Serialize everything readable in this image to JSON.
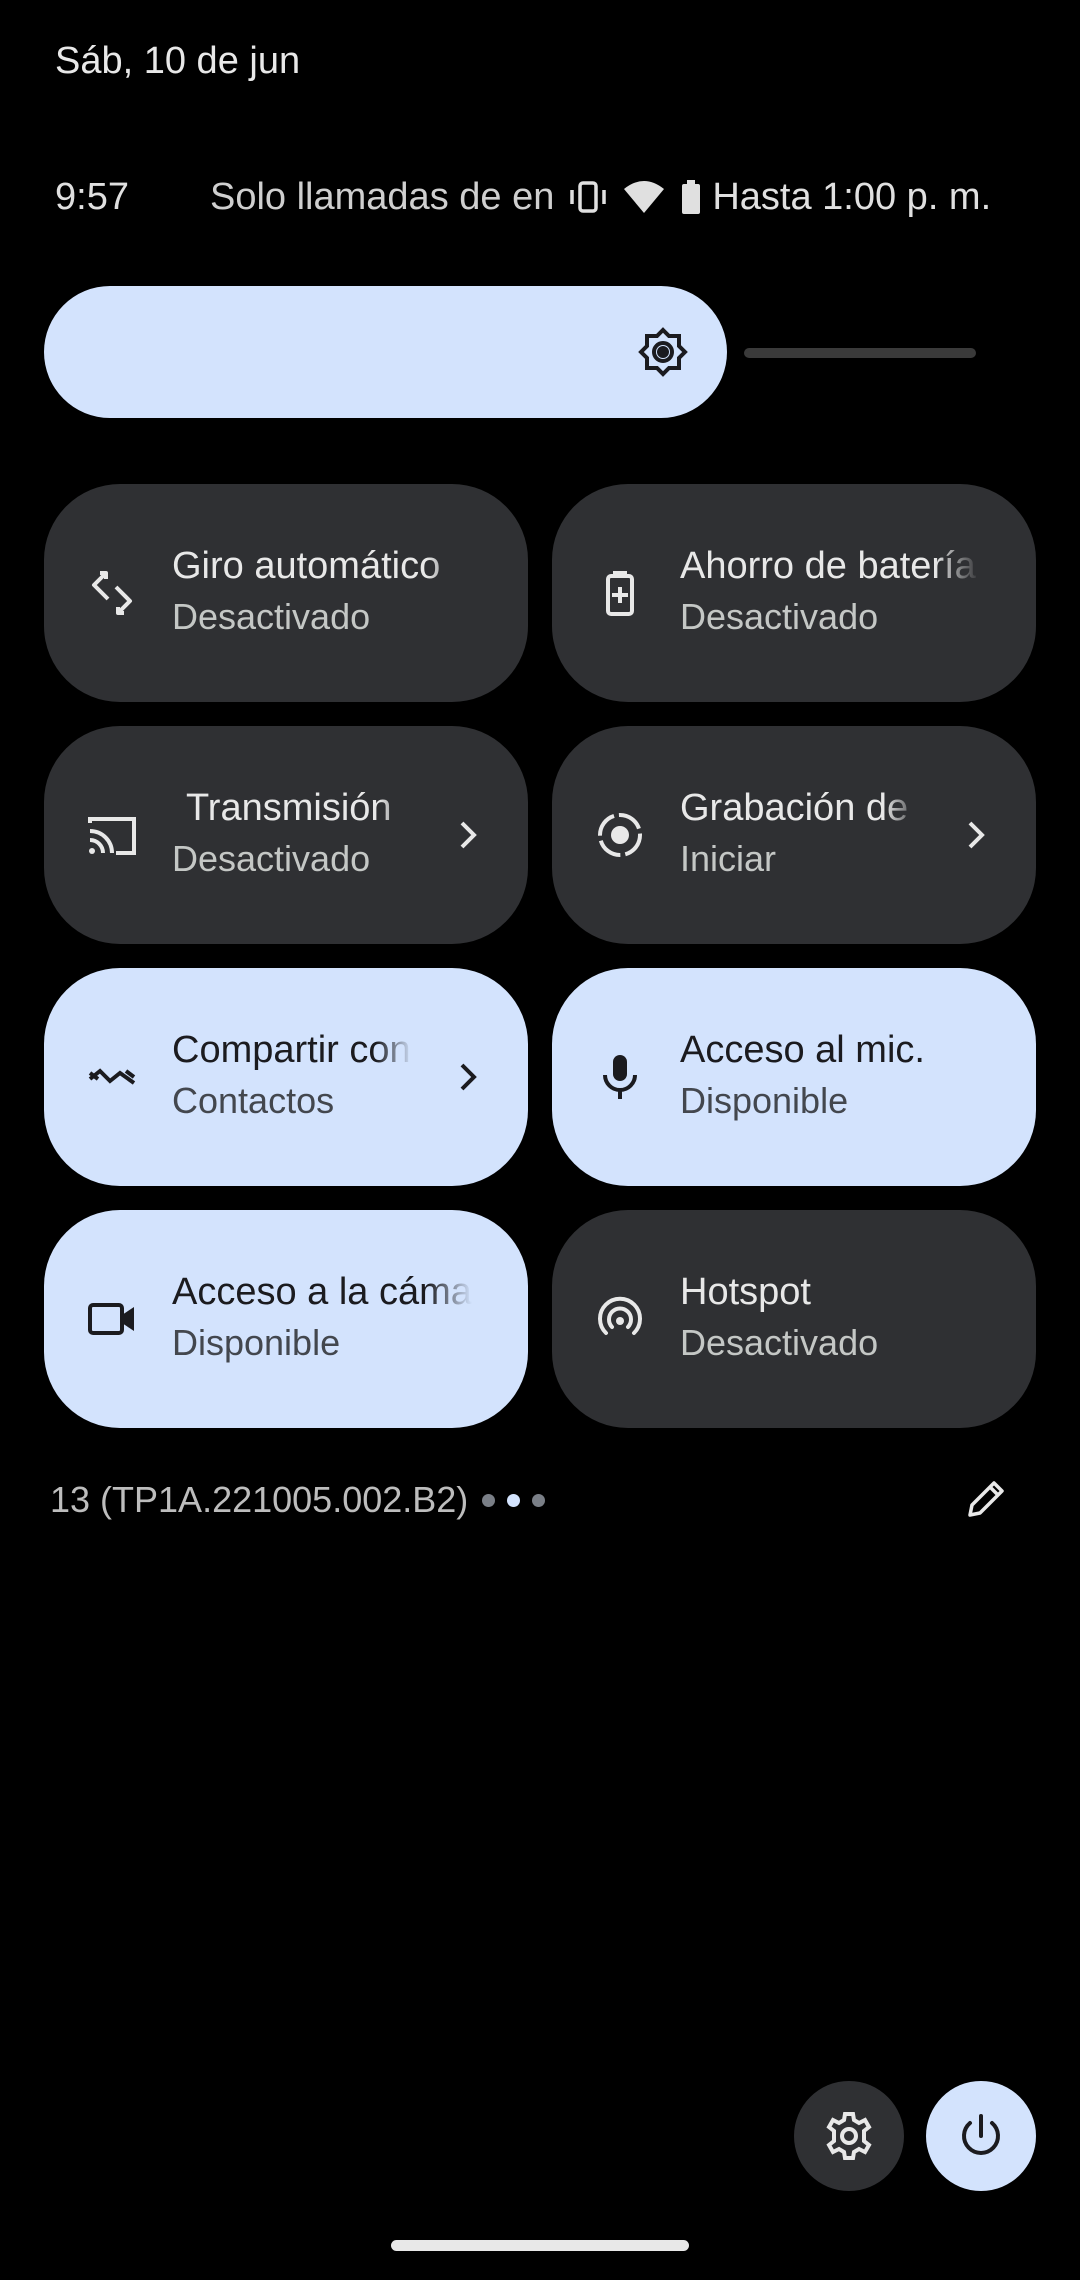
{
  "header": {
    "date": "Sáb, 10 de jun"
  },
  "status_bar": {
    "time": "9:57",
    "mode_text": "Solo llamadas de en",
    "battery_text": "Hasta 1:00 p. m.",
    "icons": [
      "vibrate-icon",
      "wifi-icon",
      "battery-icon"
    ]
  },
  "brightness": {
    "level": 0.74,
    "icon": "brightness-icon"
  },
  "tiles": [
    {
      "title": "Giro automático",
      "subtitle": "Desactivado",
      "icon": "auto-rotate-icon",
      "state": "off",
      "chevron": false
    },
    {
      "title": "Ahorro de batería",
      "subtitle": "Desactivado",
      "icon": "battery-saver-icon",
      "state": "off",
      "chevron": false
    },
    {
      "title": "Transmisión",
      "subtitle": "Desactivado",
      "icon": "cast-icon",
      "state": "off",
      "chevron": true
    },
    {
      "title": "Grabación de pantalla",
      "subtitle": "Iniciar",
      "icon": "screen-record-icon",
      "state": "off",
      "chevron": true
    },
    {
      "title": "Compartir con Nearby",
      "subtitle": "Contactos",
      "icon": "nearby-share-icon",
      "state": "on",
      "chevron": true
    },
    {
      "title": "Acceso al mic.",
      "subtitle": "Disponible",
      "icon": "mic-icon",
      "state": "on",
      "chevron": false
    },
    {
      "title": "Acceso a la cámara",
      "subtitle": "Disponible",
      "icon": "camera-icon",
      "state": "on",
      "chevron": false
    },
    {
      "title": "Hotspot",
      "subtitle": "Desactivado",
      "icon": "hotspot-icon",
      "state": "off",
      "chevron": false
    }
  ],
  "footer": {
    "build": "13 (TP1A.221005.002.B2)",
    "page_dots": 3,
    "active_dot": 1
  },
  "colors": {
    "accent": "#d3e3fd",
    "tile_off": "#2f3033",
    "background": "#000000"
  }
}
